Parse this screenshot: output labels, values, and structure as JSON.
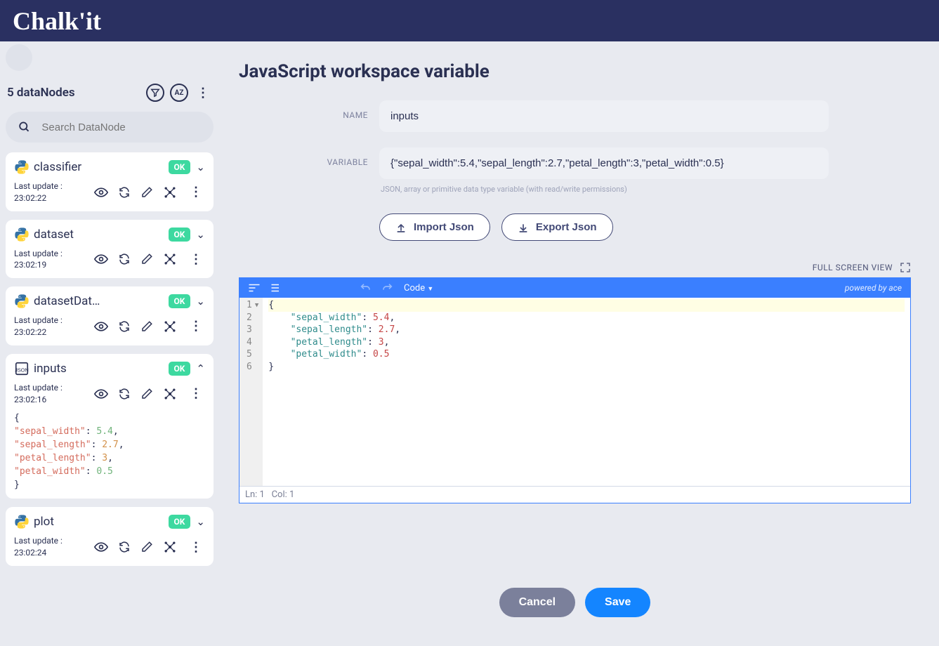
{
  "app": {
    "logo_text": "Chalk'it"
  },
  "sidebar": {
    "header": "5 dataNodes",
    "search_placeholder": "Search DataNode",
    "last_update_label": "Last update :",
    "items": [
      {
        "name": "classifier",
        "icon": "python",
        "status": "OK",
        "time": "23:02:22",
        "expanded": false
      },
      {
        "name": "dataset",
        "icon": "python",
        "status": "OK",
        "time": "23:02:19",
        "expanded": false
      },
      {
        "name": "datasetDat…",
        "icon": "python",
        "status": "OK",
        "time": "23:02:22",
        "expanded": false
      },
      {
        "name": "inputs",
        "icon": "json",
        "status": "OK",
        "time": "23:02:16",
        "expanded": true,
        "json_preview": [
          {
            "t": "brace",
            "v": "{"
          },
          {
            "t": "kv",
            "k": "\"sepal_width\"",
            "v": "5.4",
            "vc": "g",
            "comma": true
          },
          {
            "t": "kv",
            "k": "\"sepal_length\"",
            "v": "2.7",
            "vc": "o",
            "comma": true
          },
          {
            "t": "kv",
            "k": "\"petal_length\"",
            "v": "3",
            "vc": "o",
            "comma": true
          },
          {
            "t": "kv",
            "k": "\"petal_width\"",
            "v": "0.5",
            "vc": "g",
            "comma": false
          },
          {
            "t": "brace",
            "v": "}"
          }
        ]
      },
      {
        "name": "plot",
        "icon": "python",
        "status": "OK",
        "time": "23:02:24",
        "expanded": false
      }
    ]
  },
  "main": {
    "title": "JavaScript workspace variable",
    "name_label": "NAME",
    "name_value": "inputs",
    "variable_label": "VARIABLE",
    "variable_value": "{\"sepal_width\":5.4,\"sepal_length\":2.7,\"petal_length\":3,\"petal_width\":0.5}",
    "variable_hint": "JSON, array or primitive data type variable (with read/write permissions)",
    "import_json_label": "Import Json",
    "export_json_label": "Export Json",
    "fullscreen_label": "FULL SCREEN VIEW",
    "editor_toolbar": {
      "code_label": "Code",
      "powered_by": "powered by ace"
    },
    "editor_lines": [
      {
        "n": 1,
        "raw": "{",
        "fold": true,
        "hl": true
      },
      {
        "n": 2,
        "key": "\"sepal_width\"",
        "val": "5.4",
        "comma": true
      },
      {
        "n": 3,
        "key": "\"sepal_length\"",
        "val": "2.7",
        "comma": true
      },
      {
        "n": 4,
        "key": "\"petal_length\"",
        "val": "3",
        "comma": true
      },
      {
        "n": 5,
        "key": "\"petal_width\"",
        "val": "0.5",
        "comma": false
      },
      {
        "n": 6,
        "raw": "}"
      }
    ],
    "status_line": "Ln: 1",
    "status_col": "Col: 1",
    "cancel_label": "Cancel",
    "save_label": "Save"
  }
}
